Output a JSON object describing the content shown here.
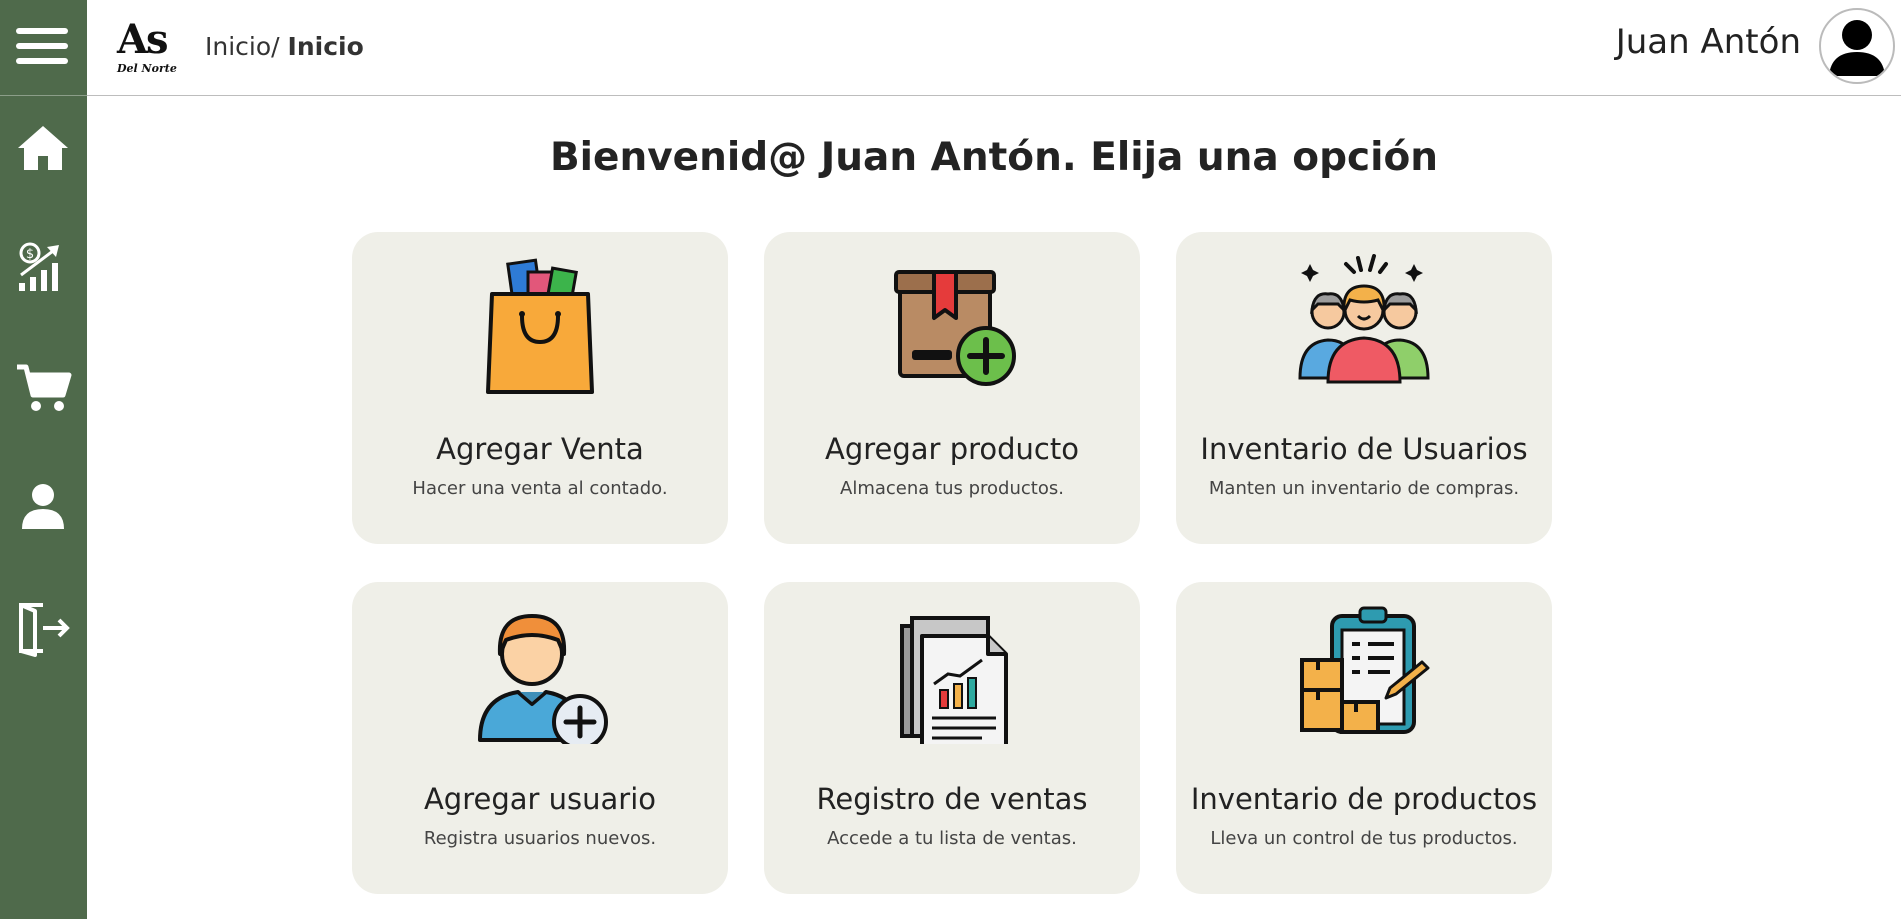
{
  "header": {
    "logo_main": "As",
    "logo_sub": "Del Norte",
    "breadcrumb_root": "Inicio/",
    "breadcrumb_current": "Inicio",
    "user_name": "Juan Antón"
  },
  "sidebar": {
    "items": [
      {
        "icon": "home-icon"
      },
      {
        "icon": "sales-chart-icon"
      },
      {
        "icon": "cart-icon"
      },
      {
        "icon": "user-icon"
      },
      {
        "icon": "logout-icon"
      }
    ]
  },
  "main": {
    "welcome": "Bienvenid@ Juan Antón. Elija una opción",
    "cards": [
      {
        "title": "Agregar Venta",
        "desc": "Hacer una venta al contado.",
        "icon": "shopping-bag-icon"
      },
      {
        "title": "Agregar producto",
        "desc": "Almacena tus productos.",
        "icon": "box-add-icon"
      },
      {
        "title": "Inventario de Usuarios",
        "desc": "Manten un inventario de compras.",
        "icon": "people-group-icon"
      },
      {
        "title": "Agregar usuario",
        "desc": "Registra usuarios nuevos.",
        "icon": "user-add-icon"
      },
      {
        "title": "Registro de ventas",
        "desc": "Accede a tu lista de ventas.",
        "icon": "report-documents-icon"
      },
      {
        "title": "Inventario de productos",
        "desc": "Lleva un control de tus productos.",
        "icon": "clipboard-boxes-icon"
      }
    ]
  },
  "colors": {
    "sidebar": "#4f6a4b",
    "card_bg": "#efefe8"
  }
}
